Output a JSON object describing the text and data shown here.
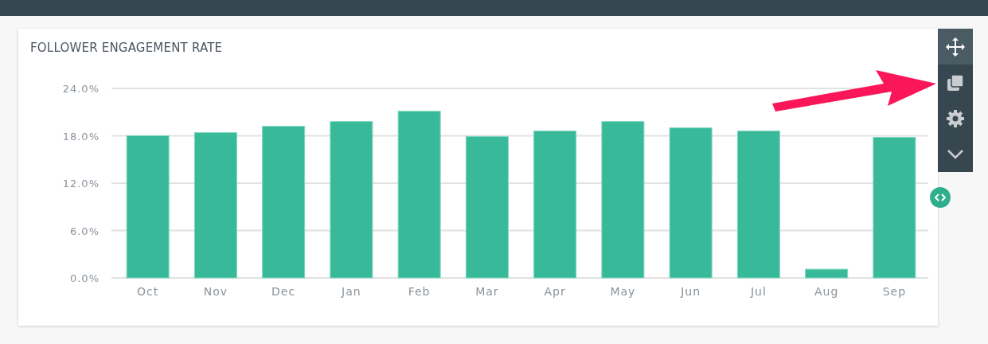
{
  "widget": {
    "title": "FOLLOWER ENGAGEMENT RATE",
    "chart_data": {
      "type": "bar",
      "categories": [
        "Oct",
        "Nov",
        "Dec",
        "Jan",
        "Feb",
        "Mar",
        "Apr",
        "May",
        "Jun",
        "Jul",
        "Aug",
        "Sep"
      ],
      "values": [
        18.0,
        18.4,
        19.2,
        19.8,
        21.1,
        17.9,
        18.6,
        19.8,
        19.0,
        18.6,
        1.1,
        17.8
      ],
      "grid": true,
      "ylim": [
        0,
        24
      ],
      "yticks": [
        {
          "value": 0,
          "label": "0.0%"
        },
        {
          "value": 6,
          "label": "6.0%"
        },
        {
          "value": 12,
          "label": "12.0%"
        },
        {
          "value": 18,
          "label": "18.0%"
        },
        {
          "value": 24,
          "label": "24.0%"
        }
      ]
    }
  },
  "toolbar": [
    {
      "kind": "move",
      "selected": true
    },
    {
      "kind": "copy",
      "selected": false
    },
    {
      "kind": "settings",
      "selected": false
    },
    {
      "kind": "collapse",
      "selected": false
    }
  ]
}
